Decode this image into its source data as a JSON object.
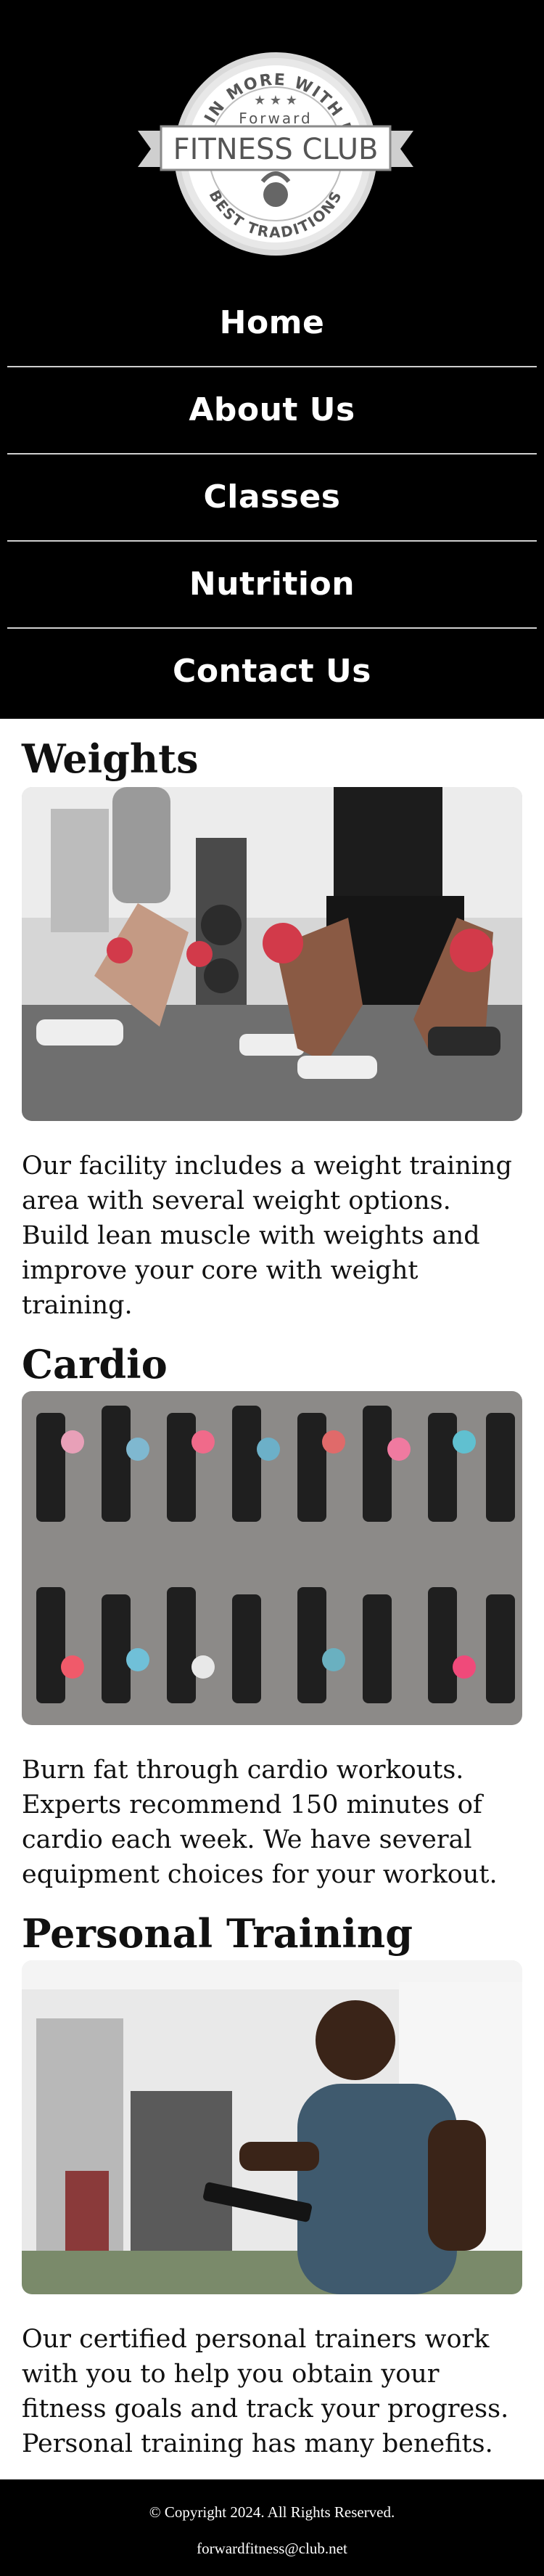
{
  "logo": {
    "arc_top": "GAIN MORE WITH US",
    "brand_small": "Forward",
    "brand_main": "FITNESS CLUB",
    "arc_bottom": "BEST TRADITIONS"
  },
  "nav": {
    "items": [
      {
        "label": "Home"
      },
      {
        "label": "About Us"
      },
      {
        "label": "Classes"
      },
      {
        "label": "Nutrition"
      },
      {
        "label": "Contact Us"
      }
    ]
  },
  "sections": [
    {
      "title": "Weights",
      "text": "Our facility includes a weight training area with several weight options. Build lean muscle with weights and improve your core with weight training."
    },
    {
      "title": "Cardio",
      "text": "Burn fat through cardio workouts. Experts recommend 150 minutes of cardio each week. We have several equipment choices for your workout."
    },
    {
      "title": "Personal Training",
      "text": "Our certified personal trainers work with you to help you obtain your fitness goals and track your progress. Personal training has many benefits."
    }
  ],
  "footer": {
    "copyright": "© Copyright 2024. All Rights Reserved.",
    "email": "forwardfitness@club.net"
  },
  "colors": {
    "header_bg": "#000000",
    "nav_text": "#ffffff",
    "divider": "#cfcfcf",
    "body_text": "#111111",
    "accent_red": "#d23a4a"
  }
}
